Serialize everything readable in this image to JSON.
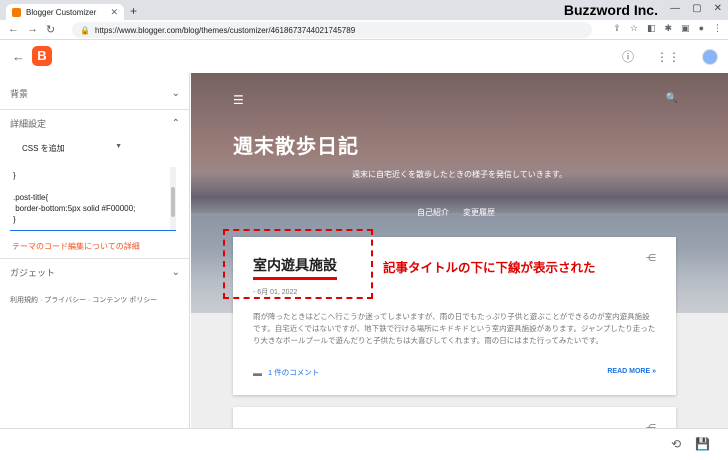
{
  "browser": {
    "tab_title": "Blogger Customizer",
    "tab_close": "✕",
    "new_tab": "+",
    "brand": "Buzzword Inc.",
    "url": "https://www.blogger.com/blog/themes/customizer/4618673744021745789"
  },
  "sidebar": {
    "background_label": "背景",
    "advanced_label": "詳細設定",
    "add_css_select": "CSS を追加",
    "css_code": "}\n\n.post-title{\n border-bottom:5px solid #F00000;\n}",
    "theme_code_link": "テーマのコード編集についての詳細",
    "gadget_label": "ガジェット",
    "footer": "利用規約 · プライバシー · コンテンツ ポリシー"
  },
  "preview": {
    "blog_title": "週末散歩日記",
    "blog_description": "週末に自宅近くを散歩したときの様子を発信していきます。",
    "nav": [
      "自己紹介",
      "変更履歴"
    ],
    "post": {
      "title": "室内遊具施設",
      "date": "- 6月 01, 2022",
      "excerpt": "雨が降ったときはどこへ行こうか迷ってしまいますが、雨の日でもたっぷり子供と遊ぶことができるのが室内遊具施設です。自宅近くではないですが、地下鉄で行ける場所にキドキドという室内遊具施設があります。ジャンプしたり走ったり大きなボールプールで遊んだりと子供たちは大喜びしてくれます。雨の日にはまた行ってみたいです。",
      "comments": "1 件のコメント",
      "read_more": "READ MORE »"
    }
  },
  "annotation": "記事タイトルの下に下線が表示された",
  "colors": {
    "accent_red": "#F00000",
    "blogger_orange": "#FF5722",
    "link_blue": "#1A73E8"
  }
}
